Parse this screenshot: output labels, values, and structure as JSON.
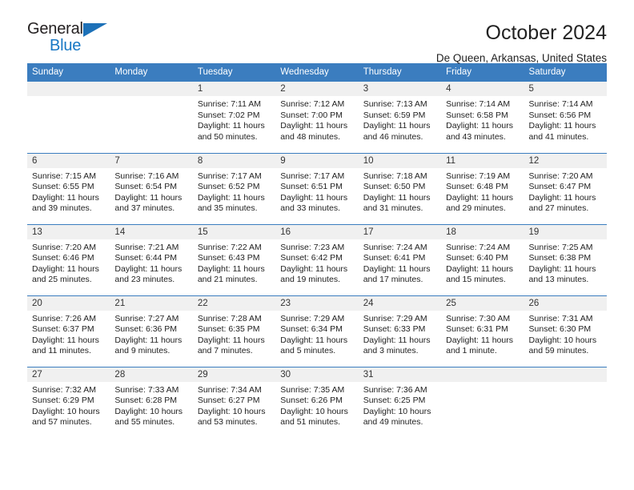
{
  "logo": {
    "word_top": "General",
    "word_bottom": "Blue",
    "triangle": "triangle-icon",
    "accent_color": "#1878c4"
  },
  "header": {
    "title": "October 2024",
    "subtitle": "De Queen, Arkansas, United States"
  },
  "theme": {
    "header_row_bg": "#3b7dbf",
    "day_band_bg": "#f0f0f0",
    "row_divider": "#3b7dbf"
  },
  "weekday_headers": [
    "Sunday",
    "Monday",
    "Tuesday",
    "Wednesday",
    "Thursday",
    "Friday",
    "Saturday"
  ],
  "weeks": [
    [
      {
        "day": "",
        "empty": true
      },
      {
        "day": "",
        "empty": true
      },
      {
        "day": "1",
        "sunrise": "Sunrise: 7:11 AM",
        "sunset": "Sunset: 7:02 PM",
        "daylight": "Daylight: 11 hours and 50 minutes."
      },
      {
        "day": "2",
        "sunrise": "Sunrise: 7:12 AM",
        "sunset": "Sunset: 7:00 PM",
        "daylight": "Daylight: 11 hours and 48 minutes."
      },
      {
        "day": "3",
        "sunrise": "Sunrise: 7:13 AM",
        "sunset": "Sunset: 6:59 PM",
        "daylight": "Daylight: 11 hours and 46 minutes."
      },
      {
        "day": "4",
        "sunrise": "Sunrise: 7:14 AM",
        "sunset": "Sunset: 6:58 PM",
        "daylight": "Daylight: 11 hours and 43 minutes."
      },
      {
        "day": "5",
        "sunrise": "Sunrise: 7:14 AM",
        "sunset": "Sunset: 6:56 PM",
        "daylight": "Daylight: 11 hours and 41 minutes."
      }
    ],
    [
      {
        "day": "6",
        "sunrise": "Sunrise: 7:15 AM",
        "sunset": "Sunset: 6:55 PM",
        "daylight": "Daylight: 11 hours and 39 minutes."
      },
      {
        "day": "7",
        "sunrise": "Sunrise: 7:16 AM",
        "sunset": "Sunset: 6:54 PM",
        "daylight": "Daylight: 11 hours and 37 minutes."
      },
      {
        "day": "8",
        "sunrise": "Sunrise: 7:17 AM",
        "sunset": "Sunset: 6:52 PM",
        "daylight": "Daylight: 11 hours and 35 minutes."
      },
      {
        "day": "9",
        "sunrise": "Sunrise: 7:17 AM",
        "sunset": "Sunset: 6:51 PM",
        "daylight": "Daylight: 11 hours and 33 minutes."
      },
      {
        "day": "10",
        "sunrise": "Sunrise: 7:18 AM",
        "sunset": "Sunset: 6:50 PM",
        "daylight": "Daylight: 11 hours and 31 minutes."
      },
      {
        "day": "11",
        "sunrise": "Sunrise: 7:19 AM",
        "sunset": "Sunset: 6:48 PM",
        "daylight": "Daylight: 11 hours and 29 minutes."
      },
      {
        "day": "12",
        "sunrise": "Sunrise: 7:20 AM",
        "sunset": "Sunset: 6:47 PM",
        "daylight": "Daylight: 11 hours and 27 minutes."
      }
    ],
    [
      {
        "day": "13",
        "sunrise": "Sunrise: 7:20 AM",
        "sunset": "Sunset: 6:46 PM",
        "daylight": "Daylight: 11 hours and 25 minutes."
      },
      {
        "day": "14",
        "sunrise": "Sunrise: 7:21 AM",
        "sunset": "Sunset: 6:44 PM",
        "daylight": "Daylight: 11 hours and 23 minutes."
      },
      {
        "day": "15",
        "sunrise": "Sunrise: 7:22 AM",
        "sunset": "Sunset: 6:43 PM",
        "daylight": "Daylight: 11 hours and 21 minutes."
      },
      {
        "day": "16",
        "sunrise": "Sunrise: 7:23 AM",
        "sunset": "Sunset: 6:42 PM",
        "daylight": "Daylight: 11 hours and 19 minutes."
      },
      {
        "day": "17",
        "sunrise": "Sunrise: 7:24 AM",
        "sunset": "Sunset: 6:41 PM",
        "daylight": "Daylight: 11 hours and 17 minutes."
      },
      {
        "day": "18",
        "sunrise": "Sunrise: 7:24 AM",
        "sunset": "Sunset: 6:40 PM",
        "daylight": "Daylight: 11 hours and 15 minutes."
      },
      {
        "day": "19",
        "sunrise": "Sunrise: 7:25 AM",
        "sunset": "Sunset: 6:38 PM",
        "daylight": "Daylight: 11 hours and 13 minutes."
      }
    ],
    [
      {
        "day": "20",
        "sunrise": "Sunrise: 7:26 AM",
        "sunset": "Sunset: 6:37 PM",
        "daylight": "Daylight: 11 hours and 11 minutes."
      },
      {
        "day": "21",
        "sunrise": "Sunrise: 7:27 AM",
        "sunset": "Sunset: 6:36 PM",
        "daylight": "Daylight: 11 hours and 9 minutes."
      },
      {
        "day": "22",
        "sunrise": "Sunrise: 7:28 AM",
        "sunset": "Sunset: 6:35 PM",
        "daylight": "Daylight: 11 hours and 7 minutes."
      },
      {
        "day": "23",
        "sunrise": "Sunrise: 7:29 AM",
        "sunset": "Sunset: 6:34 PM",
        "daylight": "Daylight: 11 hours and 5 minutes."
      },
      {
        "day": "24",
        "sunrise": "Sunrise: 7:29 AM",
        "sunset": "Sunset: 6:33 PM",
        "daylight": "Daylight: 11 hours and 3 minutes."
      },
      {
        "day": "25",
        "sunrise": "Sunrise: 7:30 AM",
        "sunset": "Sunset: 6:31 PM",
        "daylight": "Daylight: 11 hours and 1 minute."
      },
      {
        "day": "26",
        "sunrise": "Sunrise: 7:31 AM",
        "sunset": "Sunset: 6:30 PM",
        "daylight": "Daylight: 10 hours and 59 minutes."
      }
    ],
    [
      {
        "day": "27",
        "sunrise": "Sunrise: 7:32 AM",
        "sunset": "Sunset: 6:29 PM",
        "daylight": "Daylight: 10 hours and 57 minutes."
      },
      {
        "day": "28",
        "sunrise": "Sunrise: 7:33 AM",
        "sunset": "Sunset: 6:28 PM",
        "daylight": "Daylight: 10 hours and 55 minutes."
      },
      {
        "day": "29",
        "sunrise": "Sunrise: 7:34 AM",
        "sunset": "Sunset: 6:27 PM",
        "daylight": "Daylight: 10 hours and 53 minutes."
      },
      {
        "day": "30",
        "sunrise": "Sunrise: 7:35 AM",
        "sunset": "Sunset: 6:26 PM",
        "daylight": "Daylight: 10 hours and 51 minutes."
      },
      {
        "day": "31",
        "sunrise": "Sunrise: 7:36 AM",
        "sunset": "Sunset: 6:25 PM",
        "daylight": "Daylight: 10 hours and 49 minutes."
      },
      {
        "day": "",
        "empty": true
      },
      {
        "day": "",
        "empty": true
      }
    ]
  ]
}
